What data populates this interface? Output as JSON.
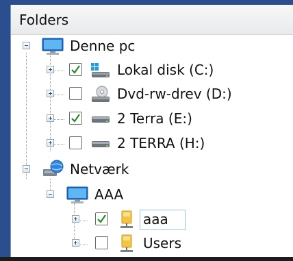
{
  "header": {
    "title": "Folders"
  },
  "tree": {
    "this_pc": {
      "label": "Denne pc",
      "icon": "monitor-icon"
    },
    "drive_c": {
      "label": "Lokal disk (C:)",
      "checked": true,
      "icon": "windows-drive-icon"
    },
    "drive_d": {
      "label": "Dvd-rw-drev (D:)",
      "checked": false,
      "icon": "dvd-drive-icon"
    },
    "drive_e": {
      "label": "2 Terra (E:)",
      "checked": true,
      "icon": "hard-drive-icon"
    },
    "drive_h": {
      "label": "2 TERRA (H:)",
      "checked": false,
      "icon": "hard-drive-icon"
    },
    "network": {
      "label": "Netværk",
      "icon": "network-globe-icon"
    },
    "aaa_computer": {
      "label": "AAA",
      "icon": "monitor-icon"
    },
    "share_aaa": {
      "label": "aaa",
      "checked": true,
      "icon": "network-folder-icon",
      "selected": true
    },
    "share_users": {
      "label": "Users",
      "checked": false,
      "icon": "network-folder-icon"
    }
  },
  "colors": {
    "background": "#2b4f8e",
    "check": "#1e8f1e",
    "selection_border": "#99c3e9"
  }
}
